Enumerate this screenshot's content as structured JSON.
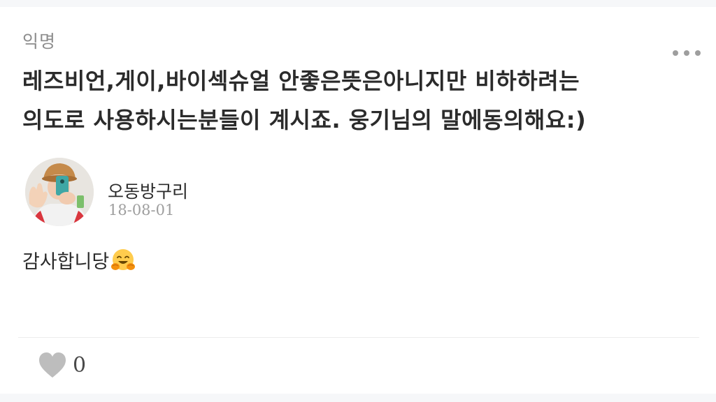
{
  "post": {
    "quoted_author": "익명",
    "quoted_text_line1": "레즈비언,게이,바이섹슈얼 안좋은뜻은아니지만 비하하려는",
    "quoted_text_line2": "의도로 사용하시는분들이 계시죠. 웅기님의 말에동의해요:)",
    "more_icon": "more-horizontal-icon"
  },
  "author": {
    "name": "오동방구리",
    "date": "18-08-01",
    "avatar_icon": "user-avatar-photo"
  },
  "comment": {
    "text": "감사합니당",
    "emoji_icon": "hugging-face-emoji"
  },
  "likes": {
    "count": "0",
    "icon": "heart-icon",
    "icon_color": "#bdbdbd"
  }
}
